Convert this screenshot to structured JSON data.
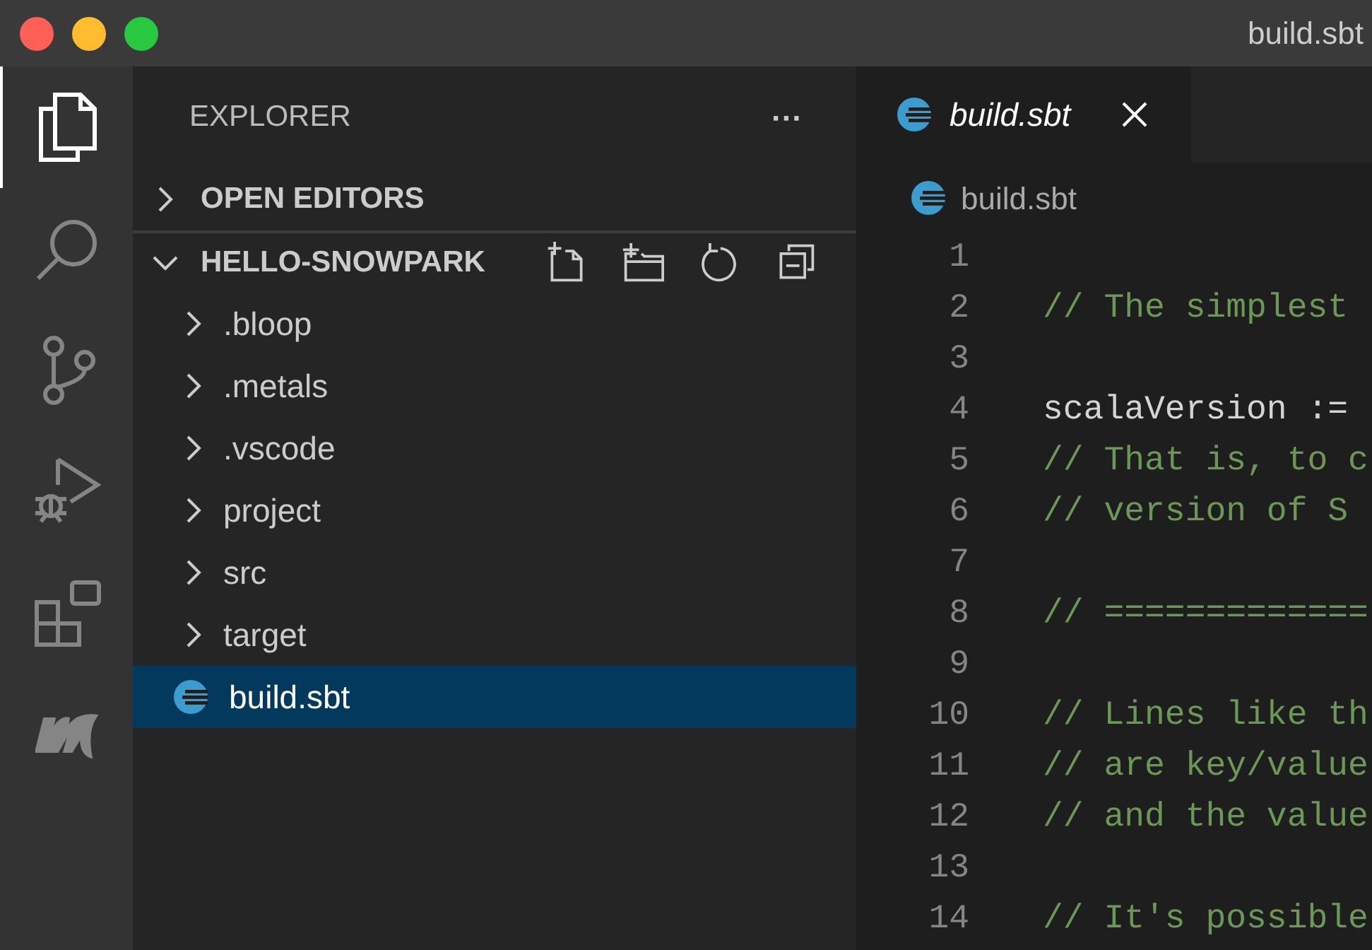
{
  "window": {
    "title": "build.sbt"
  },
  "activity_bar": [
    {
      "kind": "explorer",
      "selected": true
    },
    {
      "kind": "search",
      "selected": false
    },
    {
      "kind": "source-control",
      "selected": false
    },
    {
      "kind": "run",
      "selected": false
    },
    {
      "kind": "extensions",
      "selected": false
    },
    {
      "kind": "metals",
      "selected": false
    }
  ],
  "sidebar": {
    "title": "EXPLORER",
    "more": "···",
    "sections": [
      {
        "label": "OPEN EDITORS",
        "expanded": false
      },
      {
        "label": "HELLO-SNOWPARK",
        "expanded": true,
        "items": [
          {
            "kind": "folder",
            "label": ".bloop",
            "selected": false
          },
          {
            "kind": "folder",
            "label": ".metals",
            "selected": false
          },
          {
            "kind": "folder",
            "label": ".vscode",
            "selected": false
          },
          {
            "kind": "folder",
            "label": "project",
            "selected": false
          },
          {
            "kind": "folder",
            "label": "src",
            "selected": false
          },
          {
            "kind": "folder",
            "label": "target",
            "selected": false
          },
          {
            "kind": "file",
            "label": "build.sbt",
            "selected": true
          }
        ]
      }
    ]
  },
  "tabs": [
    {
      "label": "build.sbt",
      "selected": true
    }
  ],
  "breadcrumb": "build.sbt",
  "editor": {
    "lines": [
      {
        "number": "1",
        "kind": "blank"
      },
      {
        "number": "2",
        "kind": "comment",
        "text": "// The simplest"
      },
      {
        "number": "3",
        "kind": "blank"
      },
      {
        "number": "4",
        "kind": "code",
        "text": "scalaVersion :="
      },
      {
        "number": "5",
        "kind": "comment",
        "text": "// That is, to c"
      },
      {
        "number": "6",
        "kind": "comment",
        "text": "// version of S"
      },
      {
        "number": "7",
        "kind": "blank"
      },
      {
        "number": "8",
        "kind": "comment",
        "text": "// ============="
      },
      {
        "number": "9",
        "kind": "blank"
      },
      {
        "number": "10",
        "kind": "comment",
        "text": "// Lines like th"
      },
      {
        "number": "11",
        "kind": "comment",
        "text": "// are key/value"
      },
      {
        "number": "12",
        "kind": "comment",
        "text": "// and the value"
      },
      {
        "number": "13",
        "kind": "blank"
      },
      {
        "number": "14",
        "kind": "comment",
        "text": "// It's possible"
      }
    ]
  }
}
